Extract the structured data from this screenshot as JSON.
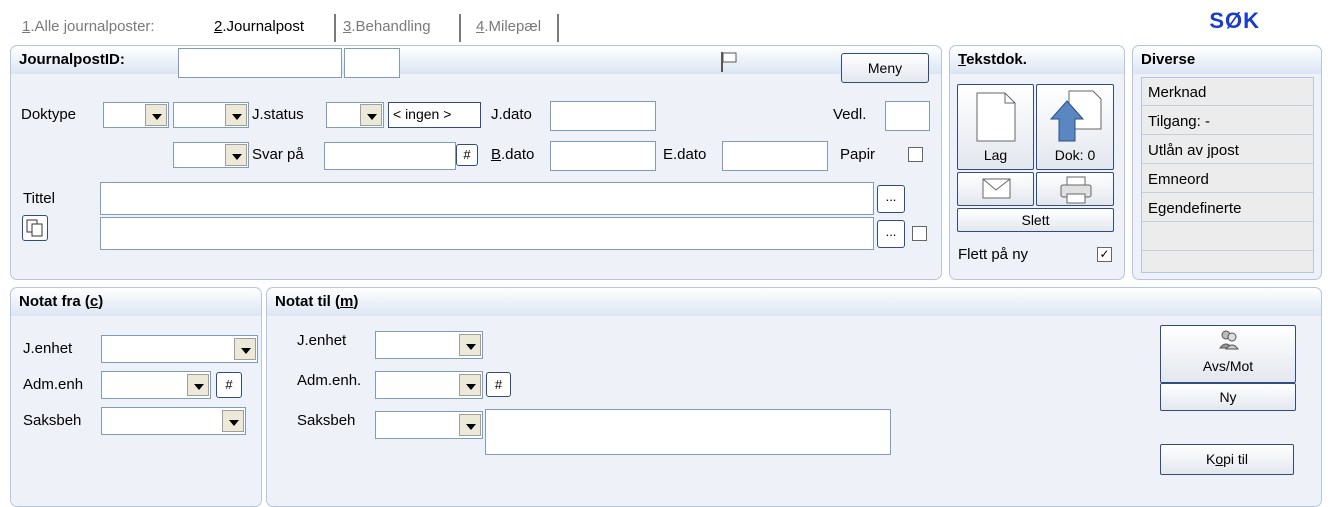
{
  "tabs": [
    {
      "num": "1",
      "label": ".Alle journalposter:"
    },
    {
      "num": "2",
      "label": ".Journalpost"
    },
    {
      "num": "3",
      "label": ".Behandling"
    },
    {
      "num": "4",
      "label": ".Milepæl"
    }
  ],
  "search_label": "SØK",
  "journalpost": {
    "title": "JournalpostID:",
    "menu_button": "Meny",
    "doktype_label": "Doktype",
    "jstatus_label": "J.status",
    "jstatus_value": "< ingen >",
    "jdato_label": "J.dato",
    "vedl_label": "Vedl.",
    "svarpaa_label": "Svar på",
    "hash": "#",
    "bdato_label": "B.dato",
    "edato_label": "E.dato",
    "papir_label": "Papir",
    "tittel_label": "Tittel",
    "ellipsis": "..."
  },
  "tekstdok": {
    "title": "Tekstdok.",
    "lag_label": "Lag",
    "dok_label": "Dok: 0",
    "slett_label": "Slett",
    "flett_label": "Flett på ny",
    "flett_checked": "✓"
  },
  "diverse": {
    "title": "Diverse",
    "items": [
      "Merknad",
      "Tilgang: -",
      "Utlån av jpost",
      "Emneord",
      "Egendefinerte"
    ]
  },
  "notat_fra": {
    "title": "Notat fra (c)",
    "jenhet_label": "J.enhet",
    "admenh_label": "Adm.enh",
    "saksbeh_label": "Saksbeh",
    "hash": "#"
  },
  "notat_til": {
    "title": "Notat til (m)",
    "jenhet_label": "J.enhet",
    "admenh_label": "Adm.enh.",
    "saksbeh_label": "Saksbeh",
    "hash": "#",
    "avsmot_label": "Avs/Mot",
    "ny_label": "Ny",
    "kopi_label": "Kopi til"
  }
}
